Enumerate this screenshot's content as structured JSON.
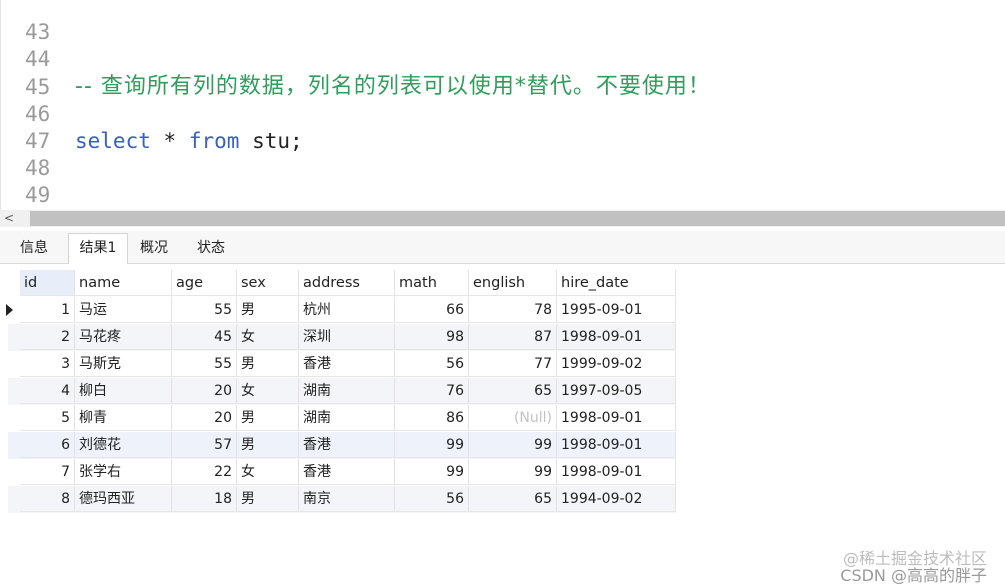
{
  "editor": {
    "lines": [
      {
        "num": "43",
        "text": ""
      },
      {
        "num": "44",
        "text": "-- 查询所有列的数据，列名的列表可以使用*替代。不要使用！"
      },
      {
        "num": "45",
        "text": ""
      },
      {
        "num": "46",
        "kw1": "select",
        "star": "*",
        "kw2": "from",
        "rest": "stu;"
      },
      {
        "num": "47",
        "text": ""
      },
      {
        "num": "48",
        "text": ""
      },
      {
        "num": "49",
        "text": ""
      }
    ]
  },
  "scrollbar": {
    "left_arrow": "<"
  },
  "tabs": [
    {
      "label": "信息"
    },
    {
      "label": "结果1"
    },
    {
      "label": "概况"
    },
    {
      "label": "状态"
    }
  ],
  "table": {
    "columns": [
      "id",
      "name",
      "age",
      "sex",
      "address",
      "math",
      "english",
      "hire_date"
    ],
    "rows": [
      [
        "1",
        "马运",
        "55",
        "男",
        "杭州",
        "66",
        "78",
        "1995-09-01"
      ],
      [
        "2",
        "马花疼",
        "45",
        "女",
        "深圳",
        "98",
        "87",
        "1998-09-01"
      ],
      [
        "3",
        "马斯克",
        "55",
        "男",
        "香港",
        "56",
        "77",
        "1999-09-02"
      ],
      [
        "4",
        "柳白",
        "20",
        "女",
        "湖南",
        "76",
        "65",
        "1997-09-05"
      ],
      [
        "5",
        "柳青",
        "20",
        "男",
        "湖南",
        "86",
        "(Null)",
        "1998-09-01"
      ],
      [
        "6",
        "刘德花",
        "57",
        "男",
        "香港",
        "99",
        "99",
        "1998-09-01"
      ],
      [
        "7",
        "张学右",
        "22",
        "女",
        "香港",
        "99",
        "99",
        "1998-09-01"
      ],
      [
        "8",
        "德玛西亚",
        "18",
        "男",
        "南京",
        "56",
        "65",
        "1994-09-02"
      ]
    ]
  },
  "watermark": {
    "line1": "@稀土掘金技术社区",
    "line2": "CSDN @高高的胖子"
  }
}
